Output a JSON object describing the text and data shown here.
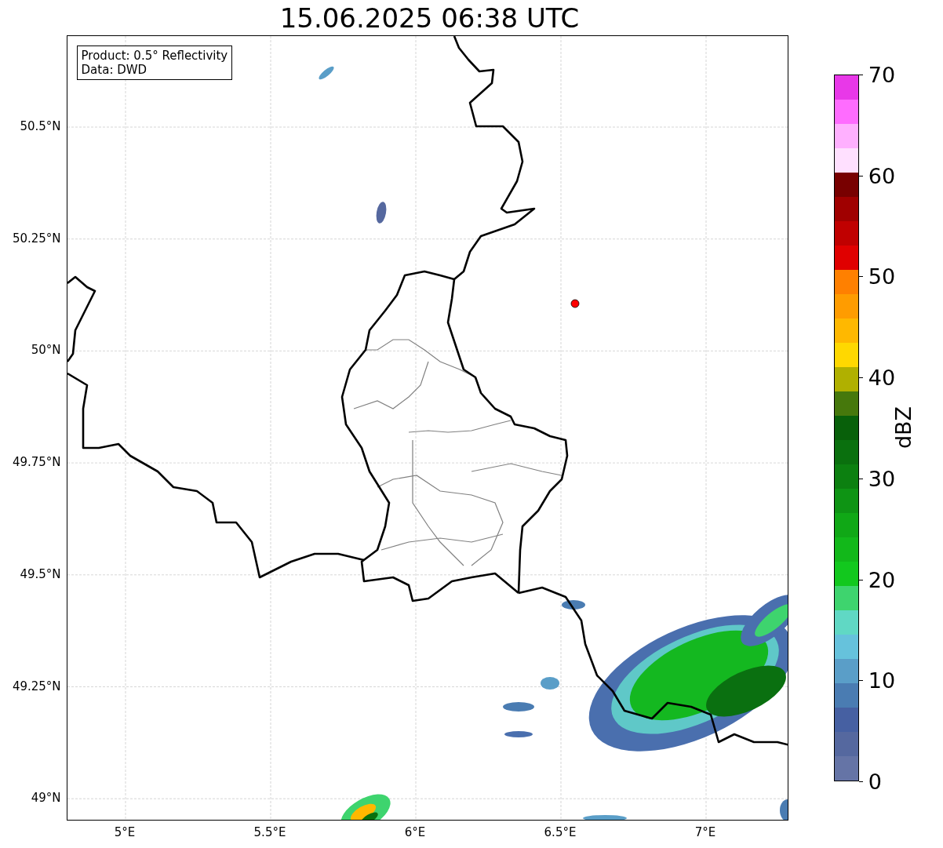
{
  "title": "15.06.2025 06:38 UTC",
  "info_box": [
    "Product: 0.5° Reflectivity",
    "Data: DWD"
  ],
  "y_ticks": [
    "50.5°N",
    "50.25°N",
    "50°N",
    "49.75°N",
    "49.5°N",
    "49.25°N",
    "49°N"
  ],
  "x_ticks": [
    "5°E",
    "5.5°E",
    "6°E",
    "6.5°E",
    "7°E"
  ],
  "colorbar": {
    "label": "dBZ",
    "ticks": [
      "70",
      "60",
      "50",
      "40",
      "30",
      "20",
      "10",
      "0"
    ],
    "bands": [
      {
        "color": "#6574a6"
      },
      {
        "color": "#55689f"
      },
      {
        "color": "#4660a2"
      },
      {
        "color": "#4a7cb2"
      },
      {
        "color": "#5a9ec8"
      },
      {
        "color": "#66c2dc"
      },
      {
        "color": "#60d8c4"
      },
      {
        "color": "#3ed46e"
      },
      {
        "color": "#12c81e"
      },
      {
        "color": "#12b81a"
      },
      {
        "color": "#10a816"
      },
      {
        "color": "#0e9414"
      },
      {
        "color": "#0c8010"
      },
      {
        "color": "#0a700e"
      },
      {
        "color": "#08600a"
      },
      {
        "color": "#46780c"
      },
      {
        "color": "#b0b000"
      },
      {
        "color": "#ffd800"
      },
      {
        "color": "#ffb800"
      },
      {
        "color": "#ff9c00"
      },
      {
        "color": "#ff8000"
      },
      {
        "color": "#e00000"
      },
      {
        "color": "#c00000"
      },
      {
        "color": "#a00000"
      },
      {
        "color": "#780000"
      },
      {
        "color": "#ffe0ff"
      },
      {
        "color": "#ffb0ff"
      },
      {
        "color": "#ff6cff"
      },
      {
        "color": "#e838e8"
      }
    ]
  }
}
